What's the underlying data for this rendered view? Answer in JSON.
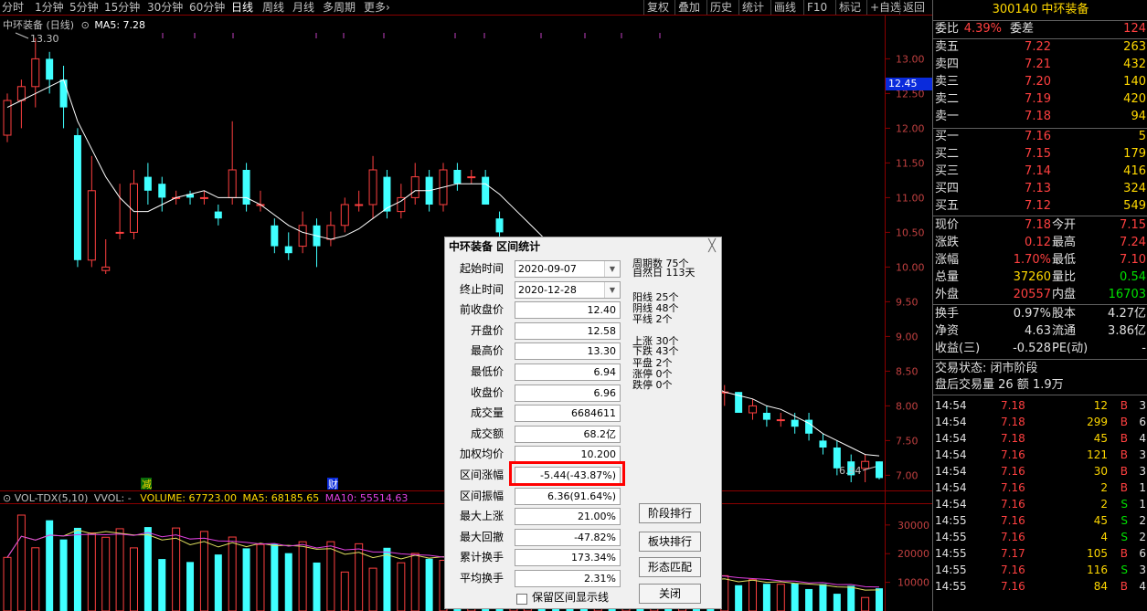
{
  "toolbar": {
    "periods": [
      "分时",
      "1分钟",
      "5分钟",
      "15分钟",
      "30分钟",
      "60分钟",
      "日线",
      "周线",
      "月线",
      "多周期",
      "更多"
    ],
    "active": "日线",
    "more_arrow": "›",
    "right_buttons": [
      "复权",
      "叠加",
      "历史",
      "统计",
      "画线",
      "F10",
      "标记",
      "+自选",
      "返回"
    ]
  },
  "chart": {
    "title": "中环装备 (日线)",
    "ma_label": "MA5: 7.28",
    "high_marker": "13.30",
    "low_marker": "6.94",
    "current_price_tag": "12.45",
    "axis_ticks": [
      "13.00",
      "12.50",
      "12.00",
      "11.50",
      "11.00",
      "10.50",
      "10.00",
      "9.50",
      "9.00",
      "8.50",
      "8.00",
      "7.50",
      "7.00"
    ],
    "markers": [
      "减",
      "财"
    ],
    "volume_legend": {
      "name": "VOL-TDX(5,10)",
      "vvol": "VVOL: -",
      "volume": "VOLUME: 67723.00",
      "ma5": "MA5: 68185.65",
      "ma10": "MA10: 55514.63"
    },
    "volume_ticks": [
      "30000",
      "20000",
      "10000"
    ]
  },
  "chart_data": {
    "type": "candlestick",
    "title": "中环装备 (日线)",
    "ylim": [
      6.9,
      13.4
    ],
    "candles": [
      {
        "o": 11.9,
        "c": 12.4,
        "h": 12.5,
        "l": 11.8
      },
      {
        "o": 12.4,
        "c": 12.6,
        "h": 12.7,
        "l": 12.0
      },
      {
        "o": 12.6,
        "c": 13.0,
        "h": 13.3,
        "l": 12.3
      },
      {
        "o": 13.0,
        "c": 12.7,
        "h": 13.1,
        "l": 12.5
      },
      {
        "o": 12.7,
        "c": 12.3,
        "h": 12.9,
        "l": 12.0
      },
      {
        "o": 11.9,
        "c": 10.1,
        "h": 12.0,
        "l": 10.0
      },
      {
        "o": 10.1,
        "c": 11.1,
        "h": 11.6,
        "l": 10.0
      },
      {
        "o": 9.95,
        "c": 10.0,
        "h": 10.4,
        "l": 9.9
      },
      {
        "o": 10.5,
        "c": 10.5,
        "h": 11.2,
        "l": 10.4
      },
      {
        "o": 10.5,
        "c": 11.2,
        "h": 11.4,
        "l": 10.4
      },
      {
        "o": 11.3,
        "c": 11.1,
        "h": 11.5,
        "l": 10.9
      },
      {
        "o": 11.2,
        "c": 11.0,
        "h": 11.3,
        "l": 10.8
      },
      {
        "o": 11.0,
        "c": 11.0,
        "h": 11.1,
        "l": 10.9
      },
      {
        "o": 11.05,
        "c": 11.0,
        "h": 11.1,
        "l": 10.9
      },
      {
        "o": 11.0,
        "c": 11.0,
        "h": 11.1,
        "l": 10.9
      },
      {
        "o": 10.8,
        "c": 10.7,
        "h": 10.9,
        "l": 10.6
      },
      {
        "o": 11.0,
        "c": 11.4,
        "h": 12.1,
        "l": 10.9
      },
      {
        "o": 11.4,
        "c": 10.9,
        "h": 11.5,
        "l": 10.8
      },
      {
        "o": 10.9,
        "c": 10.9,
        "h": 11.1,
        "l": 10.8
      },
      {
        "o": 10.6,
        "c": 10.3,
        "h": 10.7,
        "l": 10.2
      },
      {
        "o": 10.3,
        "c": 10.2,
        "h": 10.5,
        "l": 10.1
      },
      {
        "o": 10.3,
        "c": 10.6,
        "h": 10.8,
        "l": 10.2
      },
      {
        "o": 10.6,
        "c": 10.3,
        "h": 10.7,
        "l": 10.0
      },
      {
        "o": 10.4,
        "c": 10.6,
        "h": 10.8,
        "l": 10.3
      },
      {
        "o": 10.6,
        "c": 10.9,
        "h": 11.0,
        "l": 10.5
      },
      {
        "o": 10.9,
        "c": 10.9,
        "h": 11.1,
        "l": 10.8
      },
      {
        "o": 10.9,
        "c": 11.4,
        "h": 11.6,
        "l": 10.7
      },
      {
        "o": 11.3,
        "c": 10.8,
        "h": 11.4,
        "l": 10.7
      },
      {
        "o": 10.8,
        "c": 11.0,
        "h": 11.2,
        "l": 10.7
      },
      {
        "o": 11.0,
        "c": 11.3,
        "h": 11.5,
        "l": 10.9
      },
      {
        "o": 11.3,
        "c": 10.9,
        "h": 11.4,
        "l": 10.8
      },
      {
        "o": 10.9,
        "c": 11.4,
        "h": 11.5,
        "l": 10.8
      },
      {
        "o": 11.4,
        "c": 11.2,
        "h": 11.5,
        "l": 11.1
      },
      {
        "o": 11.3,
        "c": 11.3,
        "h": 11.4,
        "l": 11.2
      },
      {
        "o": 11.3,
        "c": 10.9,
        "h": 11.4,
        "l": 10.9
      },
      {
        "o": 10.7,
        "c": 10.5,
        "h": 10.8,
        "l": 10.1
      },
      {
        "o": 10.3,
        "c": 10.3,
        "h": 10.4,
        "l": 10.1
      },
      {
        "o": 10.2,
        "c": 10.2,
        "h": 10.3,
        "l": 10.0
      },
      {
        "o": 10.3,
        "c": 10.0,
        "h": 10.4,
        "l": 9.9
      },
      {
        "o": 10.0,
        "c": 9.6,
        "h": 10.1,
        "l": 9.5
      },
      {
        "o": 9.3,
        "c": 9.1,
        "h": 9.4,
        "l": 9.0
      },
      {
        "o": 9.0,
        "c": 8.6,
        "h": 9.1,
        "l": 8.6
      },
      {
        "o": 8.7,
        "c": 8.7,
        "h": 8.8,
        "l": 8.6
      },
      {
        "o": 8.8,
        "c": 8.7,
        "h": 8.9,
        "l": 8.6
      },
      {
        "o": 8.7,
        "c": 8.9,
        "h": 9.0,
        "l": 8.6
      },
      {
        "o": 8.9,
        "c": 8.7,
        "h": 9.0,
        "l": 8.6
      },
      {
        "o": 8.8,
        "c": 8.8,
        "h": 8.9,
        "l": 8.7
      },
      {
        "o": 8.4,
        "c": 8.2,
        "h": 8.5,
        "l": 8.1
      },
      {
        "o": 8.3,
        "c": 8.3,
        "h": 8.4,
        "l": 8.2
      },
      {
        "o": 8.2,
        "c": 8.1,
        "h": 8.3,
        "l": 8.0
      },
      {
        "o": 8.2,
        "c": 8.1,
        "h": 8.2,
        "l": 8.0
      },
      {
        "o": 8.2,
        "c": 8.2,
        "h": 8.3,
        "l": 8.0
      },
      {
        "o": 8.2,
        "c": 7.9,
        "h": 8.2,
        "l": 7.9
      },
      {
        "o": 7.9,
        "c": 8.0,
        "h": 8.1,
        "l": 7.8
      },
      {
        "o": 7.9,
        "c": 7.8,
        "h": 8.0,
        "l": 7.7
      },
      {
        "o": 7.8,
        "c": 7.8,
        "h": 7.9,
        "l": 7.7
      },
      {
        "o": 7.8,
        "c": 7.7,
        "h": 7.9,
        "l": 7.6
      },
      {
        "o": 7.8,
        "c": 7.6,
        "h": 7.9,
        "l": 7.5
      },
      {
        "o": 7.5,
        "c": 7.4,
        "h": 7.6,
        "l": 7.3
      },
      {
        "o": 7.4,
        "c": 7.1,
        "h": 7.5,
        "l": 7.0
      },
      {
        "o": 7.2,
        "c": 7.0,
        "h": 7.3,
        "l": 6.9
      },
      {
        "o": 7.1,
        "c": 7.2,
        "h": 7.3,
        "l": 6.9
      },
      {
        "o": 7.2,
        "c": 6.96,
        "h": 7.2,
        "l": 6.94
      }
    ],
    "ma5": [
      12.3,
      12.4,
      12.5,
      12.6,
      12.7,
      12.1,
      11.7,
      11.3,
      11.0,
      10.8,
      10.8,
      10.9,
      11.0,
      11.05,
      11.1,
      11.0,
      11.0,
      11.0,
      10.9,
      10.75,
      10.6,
      10.5,
      10.45,
      10.4,
      10.45,
      10.55,
      10.7,
      10.85,
      10.95,
      11.1,
      11.1,
      11.15,
      11.2,
      11.2,
      11.2,
      11.05,
      10.85,
      10.65,
      10.45,
      10.2,
      9.9,
      9.55,
      9.25,
      8.95,
      8.85,
      8.75,
      8.75,
      8.65,
      8.55,
      8.45,
      8.3,
      8.2,
      8.15,
      8.1,
      8.0,
      7.95,
      7.85,
      7.75,
      7.6,
      7.5,
      7.4,
      7.3,
      7.28
    ]
  },
  "right_panel": {
    "code": "300140",
    "name": "中环装备",
    "weibi": {
      "label": "委比",
      "value": "4.39%",
      "label2": "委差",
      "value2": "124"
    },
    "asks": [
      {
        "label": "卖五",
        "price": "7.22",
        "vol": "263"
      },
      {
        "label": "卖四",
        "price": "7.21",
        "vol": "432"
      },
      {
        "label": "卖三",
        "price": "7.20",
        "vol": "140"
      },
      {
        "label": "卖二",
        "price": "7.19",
        "vol": "420"
      },
      {
        "label": "卖一",
        "price": "7.18",
        "vol": "94"
      }
    ],
    "bids": [
      {
        "label": "买一",
        "price": "7.16",
        "vol": "5"
      },
      {
        "label": "买二",
        "price": "7.15",
        "vol": "179"
      },
      {
        "label": "买三",
        "price": "7.14",
        "vol": "416"
      },
      {
        "label": "买四",
        "price": "7.13",
        "vol": "324"
      },
      {
        "label": "买五",
        "price": "7.12",
        "vol": "549"
      }
    ],
    "quote": [
      {
        "l1": "现价",
        "v1": "7.18",
        "l2": "今开",
        "v2": "7.15"
      },
      {
        "l1": "涨跌",
        "v1": "0.12",
        "l2": "最高",
        "v2": "7.24"
      },
      {
        "l1": "涨幅",
        "v1": "1.70%",
        "l2": "最低",
        "v2": "7.10"
      },
      {
        "l1": "总量",
        "v1": "37260",
        "l2": "量比",
        "v2": "0.54"
      },
      {
        "l1": "外盘",
        "v1": "20557",
        "l2": "内盘",
        "v2": "16703"
      }
    ],
    "extra": [
      {
        "l1": "换手",
        "v1": "0.97%",
        "l2": "股本",
        "v2": "4.27亿"
      },
      {
        "l1": "净资",
        "v1": "4.63",
        "l2": "流通",
        "v2": "3.86亿"
      },
      {
        "l1": "收益(三)",
        "v1": "-0.528",
        "l2": "PE(动)",
        "v2": "-"
      }
    ],
    "status": "交易状态: 闭市阶段",
    "after_hours": "盘后交易量 26 额 1.9万",
    "ticks": [
      {
        "t": "14:54",
        "p": "7.18",
        "v": "12",
        "d": "B",
        "n": "3"
      },
      {
        "t": "14:54",
        "p": "7.18",
        "v": "299",
        "d": "B",
        "n": "6"
      },
      {
        "t": "14:54",
        "p": "7.18",
        "v": "45",
        "d": "B",
        "n": "4"
      },
      {
        "t": "14:54",
        "p": "7.16",
        "v": "121",
        "d": "B",
        "n": "3"
      },
      {
        "t": "14:54",
        "p": "7.16",
        "v": "30",
        "d": "B",
        "n": "3"
      },
      {
        "t": "14:54",
        "p": "7.16",
        "v": "2",
        "d": "B",
        "n": "1"
      },
      {
        "t": "14:54",
        "p": "7.16",
        "v": "2",
        "d": "S",
        "n": "1"
      },
      {
        "t": "14:55",
        "p": "7.16",
        "v": "45",
        "d": "S",
        "n": "2"
      },
      {
        "t": "14:55",
        "p": "7.16",
        "v": "4",
        "d": "S",
        "n": "2"
      },
      {
        "t": "14:55",
        "p": "7.17",
        "v": "105",
        "d": "B",
        "n": "6"
      },
      {
        "t": "14:55",
        "p": "7.16",
        "v": "116",
        "d": "S",
        "n": "3"
      },
      {
        "t": "14:55",
        "p": "7.16",
        "v": "84",
        "d": "B",
        "n": "4"
      }
    ]
  },
  "dialog": {
    "title": "中环装备 区间统计",
    "close": "╳",
    "fields": [
      {
        "label": "起始时间",
        "value": "2020-09-07",
        "date": true
      },
      {
        "label": "终止时间",
        "value": "2020-12-28",
        "date": true
      },
      {
        "label": "前收盘价",
        "value": "12.40"
      },
      {
        "label": "开盘价",
        "value": "12.58"
      },
      {
        "label": "最高价",
        "value": "13.30"
      },
      {
        "label": "最低价",
        "value": "6.94"
      },
      {
        "label": "收盘价",
        "value": "6.96"
      },
      {
        "label": "成交量",
        "value": "6684611"
      },
      {
        "label": "成交额",
        "value": "68.2亿"
      },
      {
        "label": "加权均价",
        "value": "10.200"
      },
      {
        "label": "区间涨幅",
        "value": "-5.44(-43.87%)"
      },
      {
        "label": "区间振幅",
        "value": "6.36(91.64%)"
      },
      {
        "label": "最大上涨",
        "value": "21.00%"
      },
      {
        "label": "最大回撤",
        "value": "-47.82%"
      },
      {
        "label": "累计换手",
        "value": "173.34%"
      },
      {
        "label": "平均换手",
        "value": "2.31%"
      }
    ],
    "stats": {
      "period_count": "周期数 75个",
      "natural_days": "自然日 113天",
      "yang": "阳线 25个",
      "yin": "阴线 48个",
      "flat": "平线 2个",
      "up": "上涨 30个",
      "down": "下跌 43个",
      "flat2": "平盘 2个",
      "limit_up": "涨停 0个",
      "limit_down": "跌停 0个"
    },
    "buttons": [
      "阶段排行",
      "板块排行",
      "形态匹配",
      "关闭"
    ],
    "checkbox_label": "保留区间显示线"
  },
  "colors": {
    "up": "#ff4040",
    "down": "#40ffff",
    "ma": "#ffffff",
    "highlight": "#ff0000"
  }
}
